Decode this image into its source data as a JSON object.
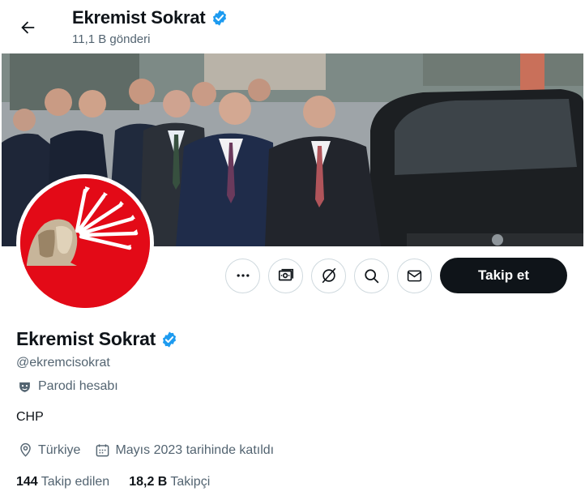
{
  "header": {
    "name": "Ekremist Sokrat",
    "posts": "11,1 B gönderi"
  },
  "profile": {
    "name": "Ekremist Sokrat",
    "handle": "@ekremcisokrat",
    "parody_label": "Parodi hesabı",
    "bio": "CHP",
    "location": "Türkiye",
    "joined": "Mayıs 2023 tarihinde katıldı",
    "following_count": "144",
    "following_label": "Takip edilen",
    "followers_count": "18,2 B",
    "followers_label": "Takipçi"
  },
  "actions": {
    "follow_label": "Takip et"
  },
  "colors": {
    "verified": "#1d9bf0",
    "primary_text": "#0f1419",
    "secondary_text": "#536471",
    "avatar_bg": "#e30a17"
  },
  "icons": [
    "back-arrow-icon",
    "verified-badge-icon",
    "more-icon",
    "money-icon",
    "grok-icon",
    "search-icon",
    "mail-icon",
    "parody-mask-icon",
    "location-icon",
    "calendar-icon"
  ]
}
